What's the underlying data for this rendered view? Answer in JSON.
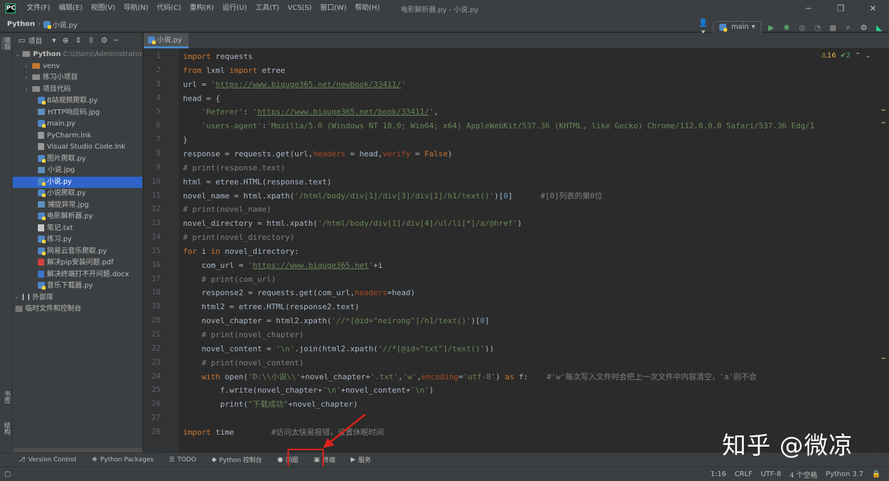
{
  "menubar": {
    "items": [
      "文件(F)",
      "编辑(E)",
      "视图(V)",
      "导航(N)",
      "代码(C)",
      "重构(R)",
      "运行(U)",
      "工具(T)",
      "VCS(S)",
      "窗口(W)",
      "帮助(H)"
    ],
    "window_title": "电影解析器.py - 小说.py"
  },
  "navbar": {
    "project": "Python",
    "file": "小说.py",
    "run_config": "main"
  },
  "left_strip": {
    "project": "项目",
    "bookmarks": "书签",
    "structure": "结构"
  },
  "project_panel": {
    "title": "项目",
    "root_name": "Python",
    "root_path": "C:\\Users\\Administrator",
    "items": [
      {
        "label": "venv",
        "kind": "folder-venv",
        "indent": 1,
        "arrow": "›"
      },
      {
        "label": "练习小项目",
        "kind": "folder",
        "indent": 1,
        "arrow": "›"
      },
      {
        "label": "项目代码",
        "kind": "folder",
        "indent": 1,
        "arrow": "›"
      },
      {
        "label": "B站视频爬取.py",
        "kind": "py",
        "indent": 2
      },
      {
        "label": "HTTP响应码.jpg",
        "kind": "img",
        "indent": 2
      },
      {
        "label": "main.py",
        "kind": "py",
        "indent": 2
      },
      {
        "label": "PyCharm.lnk",
        "kind": "generic",
        "indent": 2
      },
      {
        "label": "Visual Studio Code.lnk",
        "kind": "generic",
        "indent": 2
      },
      {
        "label": "图片爬取.py",
        "kind": "py",
        "indent": 2
      },
      {
        "label": "小说.jpg",
        "kind": "img",
        "indent": 2
      },
      {
        "label": "小说.py",
        "kind": "py",
        "indent": 2,
        "selected": true
      },
      {
        "label": "小说爬取.py",
        "kind": "py",
        "indent": 2
      },
      {
        "label": "捕捉异常.jpg",
        "kind": "img",
        "indent": 2
      },
      {
        "label": "电影解析器.py",
        "kind": "py",
        "indent": 2
      },
      {
        "label": "笔记.txt",
        "kind": "txt",
        "indent": 2
      },
      {
        "label": "练习.py",
        "kind": "py",
        "indent": 2
      },
      {
        "label": "网易云音乐爬取.py",
        "kind": "py",
        "indent": 2
      },
      {
        "label": "解决pip安装问题.pdf",
        "kind": "pdf",
        "indent": 2
      },
      {
        "label": "解决终端打不开问题.docx",
        "kind": "doc",
        "indent": 2
      },
      {
        "label": "音乐下载器.py",
        "kind": "py",
        "indent": 2
      },
      {
        "label": "外部库",
        "kind": "lib",
        "indent": 0,
        "arrow": "›"
      },
      {
        "label": "临时文件和控制台",
        "kind": "console",
        "indent": 0
      }
    ]
  },
  "editor": {
    "tab": "小说.py",
    "warnings": "⚠16",
    "weak_warnings": "✔2",
    "lines": [
      [
        [
          "kw",
          "import"
        ],
        [
          "n",
          " requests"
        ]
      ],
      [
        [
          "kw",
          "from"
        ],
        [
          "n",
          " lxml "
        ],
        [
          "kw",
          "import"
        ],
        [
          "n",
          " etree"
        ]
      ],
      [
        [
          "n",
          "url = "
        ],
        [
          "str",
          "'"
        ],
        [
          "url",
          "https://www.biquge365.net/newbook/33411/"
        ],
        [
          "str",
          "'"
        ]
      ],
      [
        [
          "n",
          "head = {"
        ]
      ],
      [
        [
          "n",
          "    "
        ],
        [
          "str",
          "'Referer'"
        ],
        [
          "n",
          ": "
        ],
        [
          "str",
          "'"
        ],
        [
          "url",
          "https://www.biquge365.net/book/33411/"
        ],
        [
          "str",
          "'"
        ],
        [
          "n",
          ","
        ]
      ],
      [
        [
          "n",
          "    "
        ],
        [
          "str",
          "'users-agent'"
        ],
        [
          "n",
          ":"
        ],
        [
          "str",
          "'Mozilla/5.0 (Windows NT 10.0; Win64; x64) AppleWebKit/537.36 (KHTML, like Gecko) Chrome/112.0.0.0 Safari/537.36 Edg/1"
        ]
      ],
      [
        [
          "n",
          "}"
        ]
      ],
      [
        [
          "n",
          "response = requests.get(url,"
        ],
        [
          "prm",
          "headers"
        ],
        [
          "n",
          " = head,"
        ],
        [
          "prm",
          "verify"
        ],
        [
          "n",
          " = "
        ],
        [
          "kw",
          "False"
        ],
        [
          "n",
          ")"
        ]
      ],
      [
        [
          "cmt",
          "# print(response.text)"
        ]
      ],
      [
        [
          "n",
          "html = etree.HTML(response.text)"
        ]
      ],
      [
        [
          "n",
          "novel_name = html.xpath("
        ],
        [
          "str",
          "'/html/body/div[1]/div[3]/div[1]/h1/text()'"
        ],
        [
          "n",
          ")["
        ],
        [
          "num",
          "0"
        ],
        [
          "n",
          "]      "
        ],
        [
          "cmt",
          "#[0]列表的第0位"
        ]
      ],
      [
        [
          "cmt",
          "# print(novel_name)"
        ]
      ],
      [
        [
          "n",
          "novel_directory = html.xpath("
        ],
        [
          "str",
          "'/html/body/div[1]/div[4]/ul/li[*]/a/@href'"
        ],
        [
          "n",
          ")"
        ]
      ],
      [
        [
          "cmt",
          "# print(novel_directory)"
        ]
      ],
      [
        [
          "kw",
          "for"
        ],
        [
          "n",
          " i "
        ],
        [
          "kw",
          "in"
        ],
        [
          "n",
          " novel_directory:"
        ]
      ],
      [
        [
          "n",
          "    com_url = "
        ],
        [
          "str",
          "'"
        ],
        [
          "url",
          "https://www.biquge365.net"
        ],
        [
          "str",
          "'"
        ],
        [
          "n",
          "+i"
        ]
      ],
      [
        [
          "n",
          "    "
        ],
        [
          "cmt",
          "# print(com_url)"
        ]
      ],
      [
        [
          "n",
          "    response2 = requests.get(com_url,"
        ],
        [
          "prm",
          "headers"
        ],
        [
          "n",
          "=head)"
        ]
      ],
      [
        [
          "n",
          "    html2 = etree.HTML(response2.text)"
        ]
      ],
      [
        [
          "n",
          "    novel_chapter = html2.xpath("
        ],
        [
          "str",
          "'//*[@id=\"neirong\"]/h1/text()'"
        ],
        [
          "n",
          ")["
        ],
        [
          "num",
          "0"
        ],
        [
          "n",
          "]"
        ]
      ],
      [
        [
          "n",
          "    "
        ],
        [
          "cmt",
          "# print(novel_chapter)"
        ]
      ],
      [
        [
          "n",
          "    novel_content = "
        ],
        [
          "str",
          "'\\n'"
        ],
        [
          "n",
          ".join(html2.xpath("
        ],
        [
          "str",
          "'//*[@id=\"txt\"]/text()'"
        ],
        [
          "n",
          "))"
        ]
      ],
      [
        [
          "n",
          "    "
        ],
        [
          "cmt",
          "# print(novel_content)"
        ]
      ],
      [
        [
          "n",
          "    "
        ],
        [
          "kw",
          "with"
        ],
        [
          "n",
          " open("
        ],
        [
          "str",
          "'D:\\\\小说\\\\'"
        ],
        [
          "n",
          "+novel_chapter+"
        ],
        [
          "str",
          "'.txt'"
        ],
        [
          "n",
          ","
        ],
        [
          "str",
          "'w'"
        ],
        [
          "n",
          ","
        ],
        [
          "prm",
          "encoding"
        ],
        [
          "n",
          "="
        ],
        [
          "str",
          "'utf-8'"
        ],
        [
          "n",
          ") "
        ],
        [
          "kw",
          "as"
        ],
        [
          "n",
          " f:    "
        ],
        [
          "cmt",
          "#'w'每次写入文件时会把上一次文件中内容清空，'a'则不会"
        ]
      ],
      [
        [
          "n",
          "        f.write(novel_chapter+"
        ],
        [
          "str",
          "'\\n'"
        ],
        [
          "n",
          "+novel_content+"
        ],
        [
          "str",
          "'\\n'"
        ],
        [
          "n",
          ")"
        ]
      ],
      [
        [
          "n",
          "        "
        ],
        [
          "n",
          "print("
        ],
        [
          "str",
          "\"下载成功\""
        ],
        [
          "n",
          "+novel_chapter)"
        ]
      ],
      [
        [
          "n",
          ""
        ]
      ],
      [
        [
          "kw",
          "import"
        ],
        [
          "n",
          " time        "
        ],
        [
          "cmt",
          "#访问太快易报错，设置休眠时间"
        ]
      ]
    ]
  },
  "toolbar_bottom": {
    "items": [
      {
        "icon": "⎇",
        "label": "Version Control",
        "name": "tool-version-control"
      },
      {
        "icon": "❖",
        "label": "Python Packages",
        "name": "tool-python-packages"
      },
      {
        "icon": "☰",
        "label": "TODO",
        "name": "tool-todo"
      },
      {
        "icon": "◆",
        "label": "Python 控制台",
        "name": "tool-python-console"
      },
      {
        "icon": "●",
        "label": "问题",
        "name": "tool-problems"
      },
      {
        "icon": "▣",
        "label": "终端",
        "name": "tool-terminal"
      },
      {
        "icon": "▶",
        "label": "服务",
        "name": "tool-services"
      }
    ]
  },
  "status_bar": {
    "position": "1:16",
    "line_sep": "CRLF",
    "encoding": "UTF-8",
    "indent": "4 个空格",
    "interpreter": "Python 3.7"
  },
  "watermark": "知乎 @微凉"
}
